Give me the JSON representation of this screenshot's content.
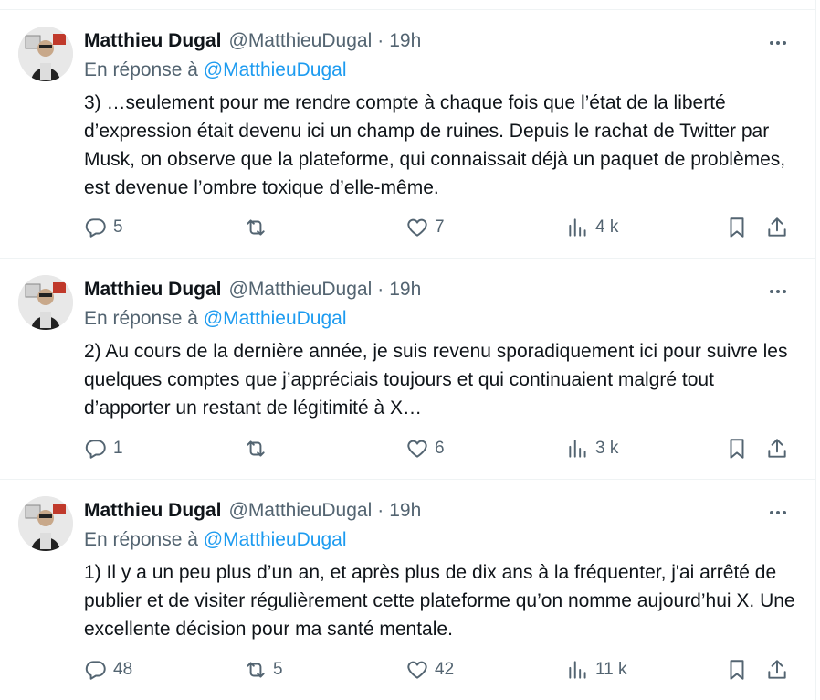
{
  "tweets": [
    {
      "author_name": "Matthieu Dugal",
      "handle": "@MatthieuDugal",
      "separator": "·",
      "time": "19h",
      "reply_prefix": "En réponse à",
      "reply_to": "@MatthieuDugal",
      "text": "3) …seulement pour me rendre compte à chaque fois que l’état de la liberté d’expression était devenu ici un champ de ruines. Depuis le rachat de Twitter par Musk, on observe que la plateforme, qui connaissait déjà un paquet de problèmes, est devenue l’ombre toxique d’elle-même.",
      "replies": "5",
      "retweets": "",
      "likes": "7",
      "views": "4 k"
    },
    {
      "author_name": "Matthieu Dugal",
      "handle": "@MatthieuDugal",
      "separator": "·",
      "time": "19h",
      "reply_prefix": "En réponse à",
      "reply_to": "@MatthieuDugal",
      "text": "2) Au cours de la dernière année, je suis revenu sporadiquement ici pour suivre les quelques comptes que j’appréciais toujours et qui continuaient malgré tout d’apporter un restant de légitimité à X…",
      "replies": "1",
      "retweets": "",
      "likes": "6",
      "views": "3 k"
    },
    {
      "author_name": "Matthieu Dugal",
      "handle": "@MatthieuDugal",
      "separator": "·",
      "time": "19h",
      "reply_prefix": "En réponse à",
      "reply_to": "@MatthieuDugal",
      "text": "1) Il y a un peu plus d’un an, et après plus de dix ans à la fréquenter, j'ai arrêté de publier et de visiter régulièrement cette plateforme qu’on nomme aujourd’hui X. Une excellente décision pour ma santé mentale.",
      "replies": "48",
      "retweets": "5",
      "likes": "42",
      "views": "11 k"
    }
  ],
  "icons": {
    "reply": "speech-bubble-icon",
    "retweet": "retweet-arrows-icon",
    "like": "heart-icon",
    "views": "bar-chart-icon",
    "bookmark": "bookmark-icon",
    "share": "share-upload-icon",
    "more": "more-dots-icon"
  },
  "colors": {
    "link": "#1d9bf0",
    "secondary_text": "#536471",
    "primary_text": "#0f1419",
    "divider": "#eff3f4"
  }
}
